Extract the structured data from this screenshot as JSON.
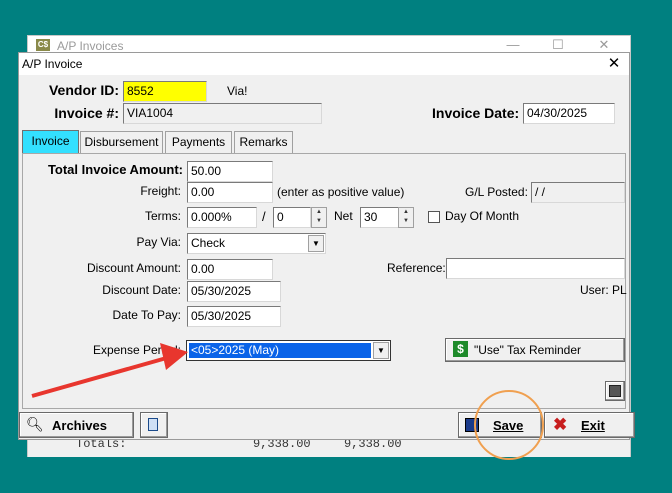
{
  "background_window": {
    "title": "A/P Invoices",
    "icon_text": "C$",
    "minimize": "—",
    "maximize": "☐",
    "close": "✕",
    "totals_label": "Totals:",
    "total_1": "9,338.00",
    "total_2": "9,338.00"
  },
  "dialog": {
    "title": "A/P Invoice",
    "close": "✕"
  },
  "header": {
    "vendor_id_label": "Vendor ID:",
    "vendor_id_value": "8552",
    "vendor_name": "Via!",
    "invoice_no_label": "Invoice #:",
    "invoice_no_value": "VIA1004",
    "invoice_date_label": "Invoice Date:",
    "invoice_date_value": "04/30/2025"
  },
  "tabs": [
    {
      "label": "Invoice",
      "active": true
    },
    {
      "label": "Disbursement",
      "active": false
    },
    {
      "label": "Payments",
      "active": false
    },
    {
      "label": "Remarks",
      "active": false
    }
  ],
  "form": {
    "total_amount_label": "Total Invoice Amount:",
    "total_amount_value": "50.00",
    "freight_label": "Freight:",
    "freight_value": "0.00",
    "freight_hint": "(enter as positive value)",
    "gl_posted_label": "G/L Posted:",
    "gl_posted_value": " / /",
    "terms_label": "Terms:",
    "terms_pct": "0.000%",
    "terms_slash": "/",
    "terms_days": "0",
    "net_label": "Net",
    "net_days": "30",
    "day_of_month_label": "Day Of Month",
    "pay_via_label": "Pay Via:",
    "pay_via_value": "Check",
    "discount_amount_label": "Discount Amount:",
    "discount_amount_value": "0.00",
    "reference_label": "Reference:",
    "reference_value": "",
    "discount_date_label": "Discount Date:",
    "discount_date_value": "05/30/2025",
    "user_label": "User: PL",
    "date_to_pay_label": "Date To Pay:",
    "date_to_pay_value": "05/30/2025",
    "expense_period_label": "Expense Period:",
    "expense_period_value": "<05>2025 (May)",
    "use_tax_button": "\"Use\" Tax Reminder"
  },
  "buttons": {
    "archives": "Archives",
    "save": "Save",
    "exit": "Exit"
  },
  "colors": {
    "desktop": "#008080",
    "highlight_yellow": "#ffff00",
    "active_tab": "#33e0ff",
    "selection": "#0a63e8",
    "annotation_arrow": "#e8362e",
    "annotation_circle": "#f0a050"
  }
}
